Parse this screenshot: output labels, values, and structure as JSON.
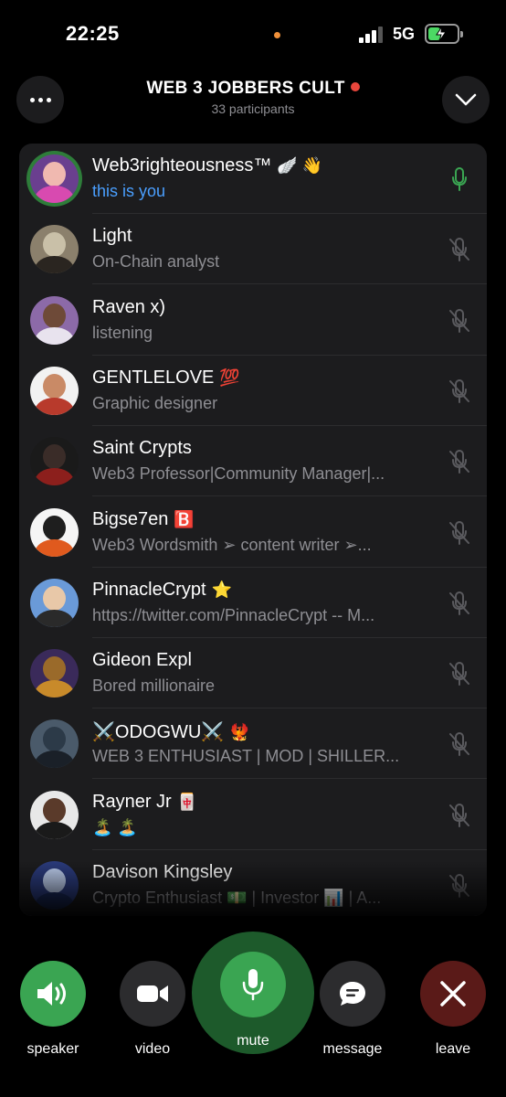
{
  "status_bar": {
    "time": "22:25",
    "network": "5G",
    "battery_percent": 44
  },
  "header": {
    "title": "WEB 3 JOBBERS CULT",
    "participants": "33 participants"
  },
  "participants": [
    {
      "name": "Web3righteousness™",
      "badge": "🪽 👋",
      "subtitle": "this is you",
      "is_you": true,
      "mic": "on",
      "avatar_head": "#f0b9b0",
      "avatar_body": "#d84ab0",
      "avatar_bg": "#6a3f8f"
    },
    {
      "name": "Light",
      "badge": "",
      "subtitle": "On-Chain analyst",
      "is_you": false,
      "mic": "off",
      "avatar_head": "#c9c0a8",
      "avatar_body": "#2a2520",
      "avatar_bg": "#8b806c"
    },
    {
      "name": "Raven x)",
      "badge": "",
      "subtitle": "listening",
      "is_you": false,
      "mic": "off",
      "avatar_head": "#6e4a38",
      "avatar_body": "#e8e3ee",
      "avatar_bg": "#8c6aa8"
    },
    {
      "name": "GENTLELOVE",
      "badge": "💯",
      "subtitle": "Graphic designer",
      "is_you": false,
      "mic": "off",
      "avatar_head": "#c98a66",
      "avatar_body": "#b83a2c",
      "avatar_bg": "#f2f2f2"
    },
    {
      "name": "Saint Crypts",
      "badge": "",
      "subtitle": "Web3 Professor|Community Manager|...",
      "is_you": false,
      "mic": "off",
      "avatar_head": "#3a2c28",
      "avatar_body": "#8c1f1c",
      "avatar_bg": "#1a1a1a"
    },
    {
      "name": "Bigse7en",
      "badge": "🅱️",
      "subtitle": "Web3 Wordsmith ➢ content writer ➢...",
      "is_you": false,
      "mic": "off",
      "avatar_head": "#1e1e1e",
      "avatar_body": "#e05a1e",
      "avatar_bg": "#f5f5f5"
    },
    {
      "name": "PinnacleCrypt",
      "badge": "⭐",
      "subtitle": "https://twitter.com/PinnacleCrypt -- M...",
      "is_you": false,
      "mic": "off",
      "avatar_head": "#e8c8a8",
      "avatar_body": "#2a2a2a",
      "avatar_bg": "#6a9ad8"
    },
    {
      "name": "Gideon Expl",
      "badge": "",
      "subtitle": "Bored millionaire",
      "is_you": false,
      "mic": "off",
      "avatar_head": "#9a6a2a",
      "avatar_body": "#c88a2a",
      "avatar_bg": "#3a2a5a"
    },
    {
      "name": "⚔️ODOGWU⚔️",
      "badge": "🐦‍🔥",
      "subtitle": "WEB 3 ENTHUSIAST | MOD | SHILLER...",
      "is_you": false,
      "mic": "off",
      "avatar_head": "#2c3a48",
      "avatar_body": "#1a2028",
      "avatar_bg": "#4a5a6a"
    },
    {
      "name": "Rayner Jr",
      "badge": "🀄",
      "subtitle": "🏝️ 🏝️",
      "is_you": false,
      "mic": "off",
      "avatar_head": "#5a3a2a",
      "avatar_body": "#1a1a1a",
      "avatar_bg": "#e8e8e8"
    },
    {
      "name": "Davison Kingsley",
      "badge": "",
      "subtitle": "Crypto Enthusiast 💵 | Investor 📊 | A...",
      "is_you": false,
      "mic": "off",
      "avatar_head": "#b8c8e8",
      "avatar_body": "#1a2a5a",
      "avatar_bg": "#2a3a7a"
    }
  ],
  "controls": {
    "speaker": {
      "label": "speaker",
      "color": "#3aa552"
    },
    "video": {
      "label": "video",
      "color": "#2c2c2e"
    },
    "mute": {
      "label": "mute",
      "color": "#3aa552"
    },
    "message": {
      "label": "message",
      "color": "#2c2c2e"
    },
    "leave": {
      "label": "leave",
      "color": "#5a1a18"
    }
  }
}
